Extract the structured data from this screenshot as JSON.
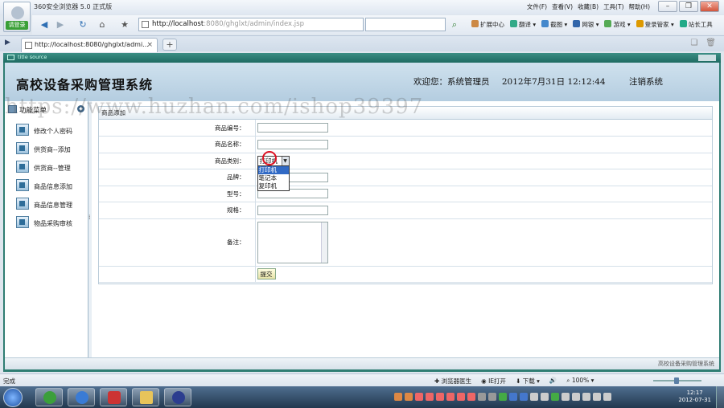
{
  "browser": {
    "title": "360安全浏览器 5.0 正式版",
    "login_label": "请登录",
    "menu": [
      "文件(F)",
      "查看(V)",
      "收藏(B)",
      "工具(T)",
      "帮助(H)"
    ],
    "address_host": "http://localhost",
    "address_path": ":8080/ghglxt/admin/index.jsp",
    "tools": [
      "扩展中心",
      "翻译",
      "截图",
      "网银",
      "游戏",
      "登录管家",
      "站长工具"
    ],
    "tab_title": "http://localhost:8080/ghglxt/admi...",
    "frame_title": "title source",
    "status_left": "完成",
    "status_tools": [
      "浏览器医生",
      "IE打开",
      "下载",
      "100%"
    ]
  },
  "header": {
    "system_title": "高校设备采购管理系统",
    "welcome": "欢迎您：系统管理员",
    "datetime": "2012年7月31日 12:12:44",
    "logout": "注销系统"
  },
  "sidebar": {
    "heading": "功能菜单",
    "items": [
      {
        "label": "修改个人密码"
      },
      {
        "label": "供货商--添加"
      },
      {
        "label": "供货商--管理"
      },
      {
        "label": "商品信息添加"
      },
      {
        "label": "商品信息管理"
      },
      {
        "label": "物品采购审核"
      }
    ]
  },
  "form": {
    "caption": "商品添加",
    "fields": {
      "code": "商品编号：",
      "name": "商品名称：",
      "category": "商品类别：",
      "brand": "品牌：",
      "model": "型号：",
      "spec": "规格：",
      "remark": "备注："
    },
    "category_selected": "打印机",
    "category_options": [
      "打印机",
      "笔记本",
      "复印机"
    ],
    "submit_label": "提交"
  },
  "footer": {
    "text": "高校设备采购管理系统"
  },
  "taskbar": {
    "clock_time": "12:17",
    "clock_date": "2012-07-31"
  },
  "watermark": "https://www.huzhan.com/ishop39397"
}
